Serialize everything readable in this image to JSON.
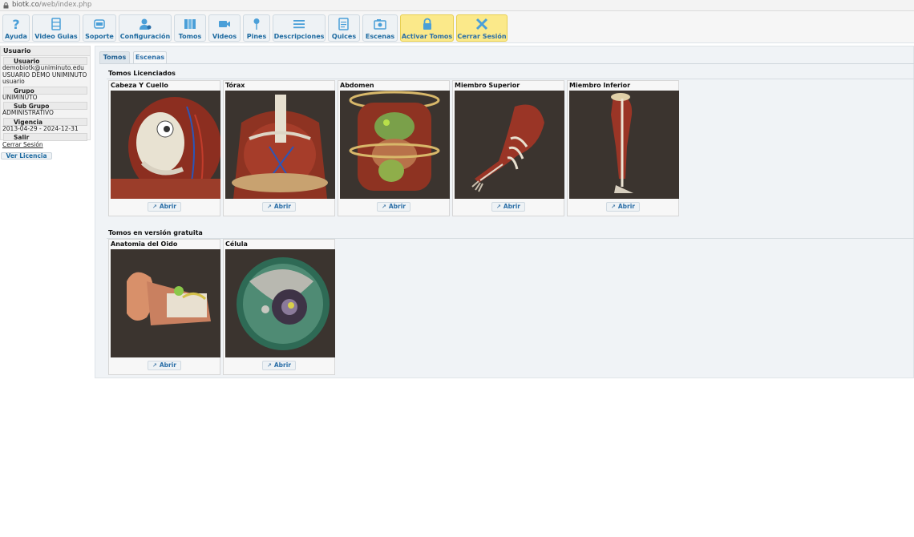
{
  "browser": {
    "url_host": "biotk.co",
    "url_path": "/web/index.php"
  },
  "toolbar": [
    {
      "label": "Ayuda",
      "icon": "question-icon"
    },
    {
      "label": "Video Guias",
      "icon": "film-icon"
    },
    {
      "label": "Soporte",
      "icon": "support-icon"
    },
    {
      "label": "Configuración",
      "icon": "user-gear-icon"
    },
    {
      "label": "Tomos",
      "icon": "books-icon"
    },
    {
      "label": "Videos",
      "icon": "video-camera-icon"
    },
    {
      "label": "Pines",
      "icon": "pin-icon"
    },
    {
      "label": "Descripciones",
      "icon": "list-icon"
    },
    {
      "label": "Quices",
      "icon": "quiz-icon"
    },
    {
      "label": "Escenas",
      "icon": "scene-icon"
    },
    {
      "label": "Activar Tomos",
      "icon": "lock-icon"
    },
    {
      "label": "Cerrar Sesión",
      "icon": "close-x-icon"
    }
  ],
  "sidebar": {
    "header": "Usuario",
    "usuario_label": "Usuario",
    "email": "demobiotk@uniminuto.edu",
    "name": "USUARIO DEMO UNIMINUTO",
    "role": "usuario",
    "grupo_label": "Grupo",
    "grupo": "UNIMINUTO",
    "subgrupo_label": "Sub Grupo",
    "subgrupo": "ADMINISTRATIVO",
    "vigencia_label": "Vigencia",
    "vigencia": "2013-04-29 - 2024-12-31",
    "salir_label": "Salir",
    "logout_link": "Cerrar Sesión",
    "license_button": "Ver Licencia"
  },
  "tabs": [
    {
      "label": "Tomos"
    },
    {
      "label": "Escenas"
    }
  ],
  "licensed": {
    "title": "Tomos Licenciados",
    "cards": [
      {
        "title": "Cabeza Y Cuello",
        "button": "Abrir"
      },
      {
        "title": "Tórax",
        "button": "Abrir"
      },
      {
        "title": "Abdomen",
        "button": "Abrir"
      },
      {
        "title": "Miembro Superior",
        "button": "Abrir"
      },
      {
        "title": "Miembro Inferior",
        "button": "Abrir"
      }
    ]
  },
  "free": {
    "title": "Tomos en versión gratuita",
    "cards": [
      {
        "title": "Anatomia del Oido",
        "button": "Abrir"
      },
      {
        "title": "Célula",
        "button": "Abrir"
      }
    ]
  },
  "colors": {
    "accent": "#2a6ea7",
    "highlight": "#fbe98a",
    "icon_blue": "#4a9fd8",
    "thumb_bg": "#3b342f"
  }
}
